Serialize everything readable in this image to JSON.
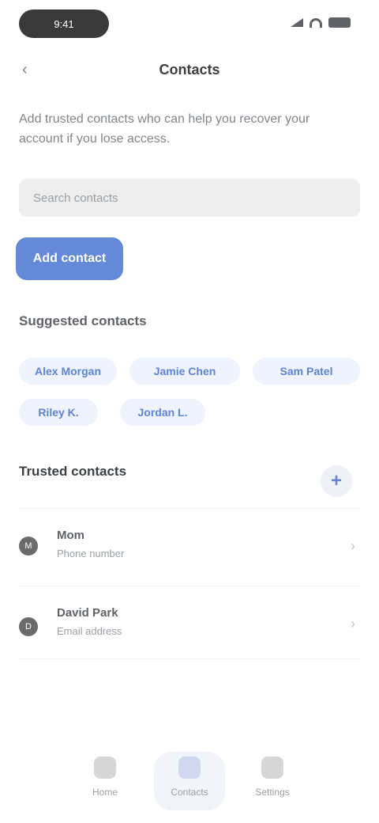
{
  "status_bar": {
    "time": "9:41"
  },
  "header": {
    "title": "Contacts"
  },
  "description": "Add trusted contacts who can help you recover your account if you lose access.",
  "search": {
    "placeholder": "Search contacts",
    "value": ""
  },
  "primary_action": {
    "label": "Add contact"
  },
  "suggested": {
    "title": "Suggested contacts",
    "chips": [
      "Alex Morgan",
      "Jamie Chen",
      "Sam Patel",
      "Riley K.",
      "Jordan L."
    ]
  },
  "contacts_section": {
    "title": "Trusted contacts",
    "add_label": "+",
    "items": [
      {
        "initial": "M",
        "name": "Mom",
        "sub": "Phone number",
        "chevron": "›"
      },
      {
        "initial": "D",
        "name": "David Park",
        "sub": "Email address",
        "chevron": "›"
      }
    ]
  },
  "bottom_nav": {
    "items": [
      {
        "label": "Home",
        "active": false
      },
      {
        "label": "Contacts",
        "active": true
      },
      {
        "label": "Settings",
        "active": false
      }
    ]
  },
  "colors": {
    "accent": "#6489d9",
    "chip_bg": "#eef3fd",
    "chip_text": "#5f84d6"
  }
}
